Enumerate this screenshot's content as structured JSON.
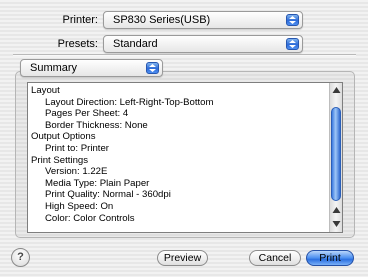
{
  "printer": {
    "label": "Printer:",
    "value": "SP830 Series(USB)"
  },
  "presets": {
    "label": "Presets:",
    "value": "Standard"
  },
  "panel": {
    "value": "Summary"
  },
  "summary_lines": [
    {
      "text": "Layout",
      "indent": false
    },
    {
      "text": "Layout Direction:  Left-Right-Top-Bottom",
      "indent": true
    },
    {
      "text": "Pages Per Sheet:  4",
      "indent": true
    },
    {
      "text": "Border Thickness:  None",
      "indent": true
    },
    {
      "text": "Output Options",
      "indent": false
    },
    {
      "text": "Print to:  Printer",
      "indent": true
    },
    {
      "text": "Print Settings",
      "indent": false
    },
    {
      "text": "Version:  1.22E",
      "indent": true
    },
    {
      "text": "Media Type:  Plain Paper",
      "indent": true
    },
    {
      "text": "Print Quality:  Normal - 360dpi",
      "indent": true
    },
    {
      "text": "High Speed:  On",
      "indent": true
    },
    {
      "text": "Color:  Color Controls",
      "indent": true
    }
  ],
  "buttons": {
    "help": "?",
    "preview": "Preview",
    "cancel": "Cancel",
    "print": "Print"
  },
  "icons": {
    "popup": "updown-arrows-icon",
    "help": "help-icon",
    "scroll_up": "scroll-up-arrow-icon",
    "scroll_down": "scroll-down-arrow-icon"
  },
  "colors": {
    "accent": "#2c6ad8",
    "background": "#ececec"
  }
}
